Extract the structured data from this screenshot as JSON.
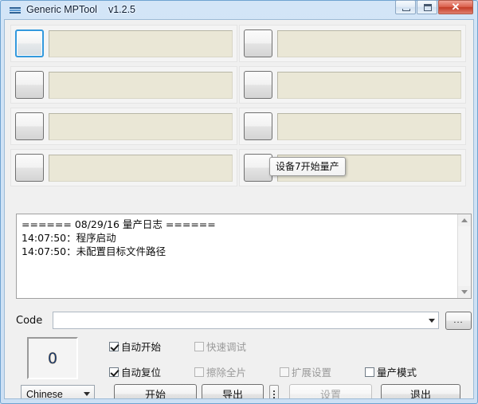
{
  "window": {
    "title": "Generic MPTool",
    "version": "v1.2.5",
    "icon": "app-stripes-icon",
    "buttons": {
      "minimize": "minimize-icon",
      "maximize": "maximize-icon",
      "close": "✕"
    }
  },
  "devices": [
    {
      "index": 1,
      "label": "",
      "focused": true
    },
    {
      "index": 2,
      "label": "",
      "focused": false
    },
    {
      "index": 3,
      "label": "",
      "focused": false
    },
    {
      "index": 4,
      "label": "",
      "focused": false
    },
    {
      "index": 5,
      "label": "",
      "focused": false
    },
    {
      "index": 6,
      "label": "",
      "focused": false
    },
    {
      "index": 7,
      "label": "",
      "focused": false
    },
    {
      "index": 8,
      "label": "",
      "focused": false
    }
  ],
  "tooltip": {
    "text": "设备7开始量产"
  },
  "log": {
    "lines": [
      "====== 08/29/16 量产日志 ======",
      "14:07:50：程序启动",
      "14:07:50：未配置目标文件路径"
    ],
    "text": "====== 08/29/16 量产日志 ======\n14:07:50：程序启动\n14:07:50：未配置目标文件路径",
    "scrollbar": {
      "up": "scroll-up-icon",
      "down": "scroll-down-icon"
    }
  },
  "code_row": {
    "label": "Code",
    "value": "",
    "placeholder": "",
    "browse_label": "...",
    "dropdown_icon": "chevron-down-icon"
  },
  "counter": {
    "value": "0"
  },
  "options": [
    {
      "id": "auto-start",
      "label": "自动开始",
      "checked": true,
      "disabled": false
    },
    {
      "id": "quick-debug",
      "label": "快速调试",
      "checked": false,
      "disabled": true
    },
    {
      "id": "auto-reset",
      "label": "自动复位",
      "checked": true,
      "disabled": false
    },
    {
      "id": "erase-all",
      "label": "擦除全片",
      "checked": false,
      "disabled": true
    },
    {
      "id": "extend-config",
      "label": "扩展设置",
      "checked": false,
      "disabled": true
    },
    {
      "id": "mass-prod",
      "label": "量产模式",
      "checked": false,
      "disabled": false
    }
  ],
  "footer": {
    "language": "Chinese",
    "language_arrow": "chevron-down-icon",
    "start": "开始",
    "export": "导出",
    "more": "vertical-dots-icon",
    "settings": "设置",
    "exit": "退出"
  },
  "colors": {
    "frame": "#cfe2f5",
    "frame_border": "#6fa3d1",
    "client_bg": "#f0f0f0",
    "device_field": "#eae7d6",
    "focus_blue": "#3399dd",
    "close_red": "#c33c26",
    "disabled_text": "#9a9a9a"
  }
}
